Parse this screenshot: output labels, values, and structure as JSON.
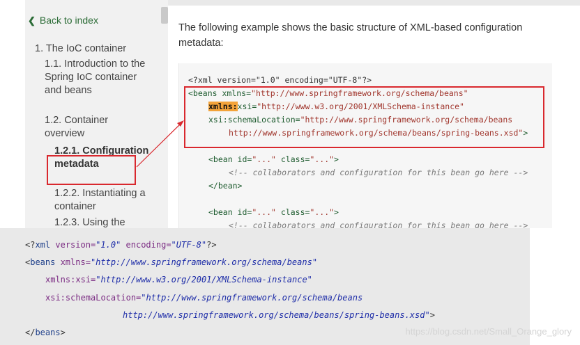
{
  "sidebar": {
    "back_label": "Back to index",
    "items": [
      {
        "label": "1. The IoC container"
      },
      {
        "label": "1.1. Introduction to the Spring IoC container and beans"
      },
      {
        "label": "1.2. Container overview"
      },
      {
        "label": "1.2.1. Configuration metadata",
        "active": true
      },
      {
        "label": "1.2.2. Instantiating a container"
      },
      {
        "label": "1.2.3. Using the"
      }
    ]
  },
  "main": {
    "intro": "The following example shows the basic structure of XML-based configuration metadata:",
    "code": {
      "l1": "<?xml version=\"1.0\" encoding=\"UTF-8\"?>",
      "l2_tag": "<beans",
      "l2_attr": " xmlns=",
      "l2_val": "\"http://www.springframework.org/schema/beans\"",
      "l3_ns": "xmlns:",
      "l3_attr": "xsi=",
      "l3_val": "\"http://www.w3.org/2001/XMLSchema-instance\"",
      "l4_attr": "xsi:schemaLocation=",
      "l4_val": "\"http://www.springframework.org/schema/beans",
      "l5_val": "http://www.springframework.org/schema/beans/spring-beans.xsd\"",
      "l5_end": ">",
      "bean_open": "<bean",
      "bean_id": " id=",
      "bean_id_val": "\"...\"",
      "bean_class": " class=",
      "bean_class_val": "\"...\"",
      "bean_gt": ">",
      "comment": "<!-- collaborators and configuration for this bean go here -->",
      "bean_close": "</bean>"
    }
  },
  "bottom_code": {
    "l1_open": "<?",
    "l1_xml": "xml",
    "l1_version": " version=",
    "l1_version_val": "\"1.0\"",
    "l1_encoding": " encoding=",
    "l1_encoding_val": "\"UTF-8\"",
    "l1_close": "?>",
    "l2_lt": "<",
    "l2_tag": "beans",
    "l2_attr": " xmlns=",
    "l2_val": "\"http://www.springframework.org/schema/beans\"",
    "l3_attr": "xmlns:xsi=",
    "l3_val": "\"http://www.w3.org/2001/XMLSchema-instance\"",
    "l4_attr": "xsi:schemaLocation=",
    "l4_val": "\"http://www.springframework.org/schema/beans",
    "l5_val": "http://www.springframework.org/schema/beans/spring-beans.xsd\"",
    "l5_end": ">",
    "l6_lt": "</",
    "l6_tag": "beans",
    "l6_gt": ">"
  },
  "watermark": "https://blog.csdn.net/Small_Orange_glory",
  "colors": {
    "highlight": "#d9282e",
    "accent_green": "#2a6b35",
    "ns_mark": "#f3a33a"
  }
}
